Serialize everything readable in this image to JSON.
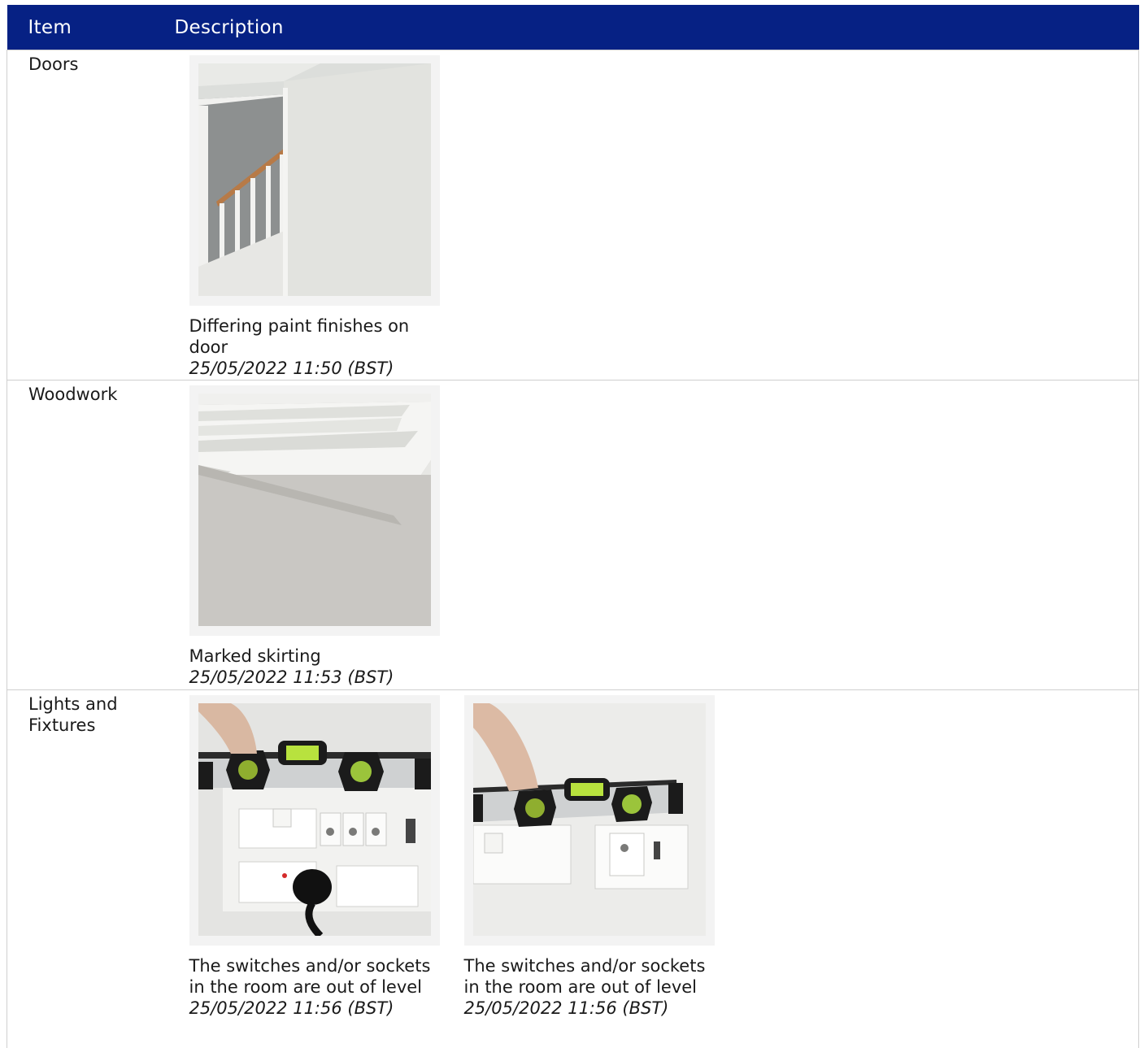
{
  "table": {
    "headers": {
      "item": "Item",
      "description": "Description"
    },
    "rows": [
      {
        "item": "Doors",
        "photos": [
          {
            "image": "staircase-door-photo",
            "caption": "Differing paint finishes on door",
            "timestamp": "25/05/2022 11:50 (BST)"
          }
        ]
      },
      {
        "item": "Woodwork",
        "photos": [
          {
            "image": "skirting-carpet-photo",
            "caption": "Marked skirting",
            "timestamp": "25/05/2022 11:53 (BST)"
          }
        ]
      },
      {
        "item": "Lights and Fixtures",
        "photos": [
          {
            "image": "spirit-level-sockets-photo",
            "caption": "The switches and/or sockets in the room are out of level",
            "timestamp": "25/05/2022 11:56 (BST)"
          },
          {
            "image": "spirit-level-socket-photo",
            "caption": "The switches and/or sockets in the room are out of level",
            "timestamp": "25/05/2022 11:56 (BST)"
          }
        ]
      }
    ]
  },
  "colors": {
    "header_bg": "#062184",
    "header_text": "#ffffff",
    "border": "#cfcfcf"
  }
}
